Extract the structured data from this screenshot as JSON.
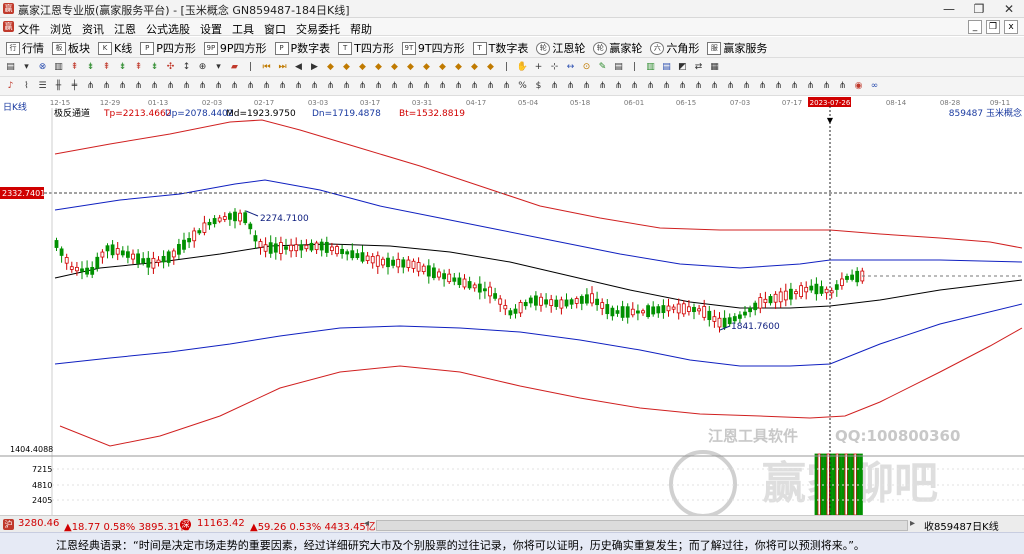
{
  "window": {
    "title": "赢家江恩专业版(赢家服务平台) - [玉米概念  GN859487-184日K线]",
    "buttons": [
      "—",
      "❐",
      "✕"
    ]
  },
  "menu": {
    "items": [
      "文件",
      "浏览",
      "资讯",
      "江恩",
      "公式选股",
      "设置",
      "工具",
      "窗口",
      "交易委托",
      "帮助"
    ],
    "mdi": [
      "_",
      "❐",
      "x"
    ]
  },
  "toolbar1": [
    {
      "icon": "行",
      "label": "行情"
    },
    {
      "icon": "板",
      "label": "板块"
    },
    {
      "icon": "K",
      "label": "K线"
    },
    {
      "icon": "P",
      "label": "P四方形"
    },
    {
      "icon": "9P",
      "label": "9P四方形"
    },
    {
      "icon": "P",
      "label": "P数字表"
    },
    {
      "icon": "T",
      "label": "T四方形"
    },
    {
      "icon": "9T",
      "label": "9T四方形"
    },
    {
      "icon": "T",
      "label": "T数字表"
    },
    {
      "icon": "轮",
      "label": "江恩轮"
    },
    {
      "icon": "轮",
      "label": "赢家轮"
    },
    {
      "icon": "六",
      "label": "六角形"
    },
    {
      "icon": "服",
      "label": "赢家服务"
    }
  ],
  "toolbar3_text": {
    "percent": "%",
    "dollar": "$"
  },
  "chart": {
    "period_label": "日K线",
    "indicator_name": "极反通道",
    "params": {
      "tp": "Tp=2213.4662",
      "up": "Up=2078.4402",
      "md": "Md=1923.9750",
      "dn": "Dn=1719.4878",
      "bt": "Bt=1532.8819"
    },
    "symbol_label": "859487  玉米概念",
    "date_ticks": [
      "12-15",
      "12-29",
      "01-13",
      "02-03",
      "02-17",
      "03-03",
      "03-17",
      "03-31",
      "04-17",
      "05-04",
      "05-18",
      "06-01",
      "06-15",
      "07-03",
      "07-17",
      "2023-07-26",
      "08-14",
      "08-28",
      "09-11"
    ],
    "cursor_price": "2332.7401",
    "annotations": {
      "high": "2274.7100",
      "low": "1841.7600"
    },
    "bottom_price": "1404.4088",
    "volume_ticks": [
      "7215",
      "4810",
      "2405"
    ],
    "watermark": {
      "brand": "江恩工具软件",
      "qq": "QQ:100800360",
      "forum": "赢家聊吧"
    }
  },
  "colors": {
    "upper_band": "#d02020",
    "mid_band": "#1020c0",
    "center_line": "#000000",
    "up_candle": "#d00000",
    "down_candle": "#009000",
    "annotation": "#102080",
    "label_blue": "#1a3aa0"
  },
  "statusbar": {
    "index1": "3280.46",
    "index1_change": "▲18.77  0.58%  3895.31亿",
    "index2": "11163.42",
    "index2_change": "▲59.26  0.53%  4433.45亿",
    "right_label": "收859487日K线"
  },
  "footer": {
    "quote": "江恩经典语录：“时间是决定市场走势的重要因素，经过详细研究大市及个别股票的过往记录，你将可以证明，历史确实重复发生；而了解过往，你将可以预测将来。”。"
  }
}
